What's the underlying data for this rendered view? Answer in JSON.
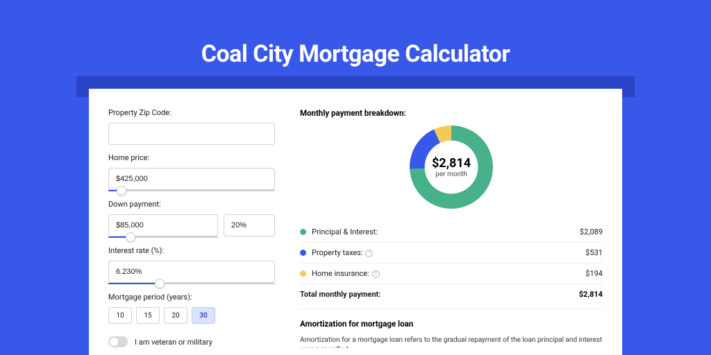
{
  "page": {
    "title": "Coal City Mortgage Calculator"
  },
  "form": {
    "zip_label": "Property Zip Code:",
    "zip_value": "",
    "home_price_label": "Home price:",
    "home_price_value": "$425,000",
    "home_price_slider_pct": 8,
    "down_payment_label": "Down payment:",
    "down_payment_amount": "$85,000",
    "down_payment_pct": "20%",
    "down_payment_slider_pct": 20,
    "interest_label": "Interest rate (%):",
    "interest_value": "6.230%",
    "interest_slider_pct": 31,
    "period_label": "Mortgage period (years):",
    "period_options": [
      "10",
      "15",
      "20",
      "30"
    ],
    "period_selected": "30",
    "veteran_label": "I am veteran or military",
    "veteran_on": false
  },
  "breakdown": {
    "title": "Monthly payment breakdown:",
    "center_amount": "$2,814",
    "center_sub": "per month",
    "items": [
      {
        "key": "pi",
        "color": "#47B28A",
        "label": "Principal & Interest:",
        "value": "$2,089",
        "info": false
      },
      {
        "key": "tax",
        "color": "#3858E9",
        "label": "Property taxes:",
        "value": "$531",
        "info": true
      },
      {
        "key": "ins",
        "color": "#F2CB57",
        "label": "Home insurance:",
        "value": "$194",
        "info": true
      }
    ],
    "total_label": "Total monthly payment:",
    "total_value": "$2,814"
  },
  "chart_data": {
    "type": "pie",
    "title": "Monthly payment breakdown",
    "series": [
      {
        "name": "Principal & Interest",
        "value": 2089,
        "color": "#47B28A"
      },
      {
        "name": "Property taxes",
        "value": 531,
        "color": "#3858E9"
      },
      {
        "name": "Home insurance",
        "value": 194,
        "color": "#F2CB57"
      }
    ],
    "total": 2814,
    "center_label": "$2,814",
    "center_sub": "per month",
    "donut_inner_ratio": 0.64
  },
  "amortization": {
    "title": "Amortization for mortgage loan",
    "body": "Amortization for a mortgage loan refers to the gradual repayment of the loan principal and interest over a specified"
  }
}
